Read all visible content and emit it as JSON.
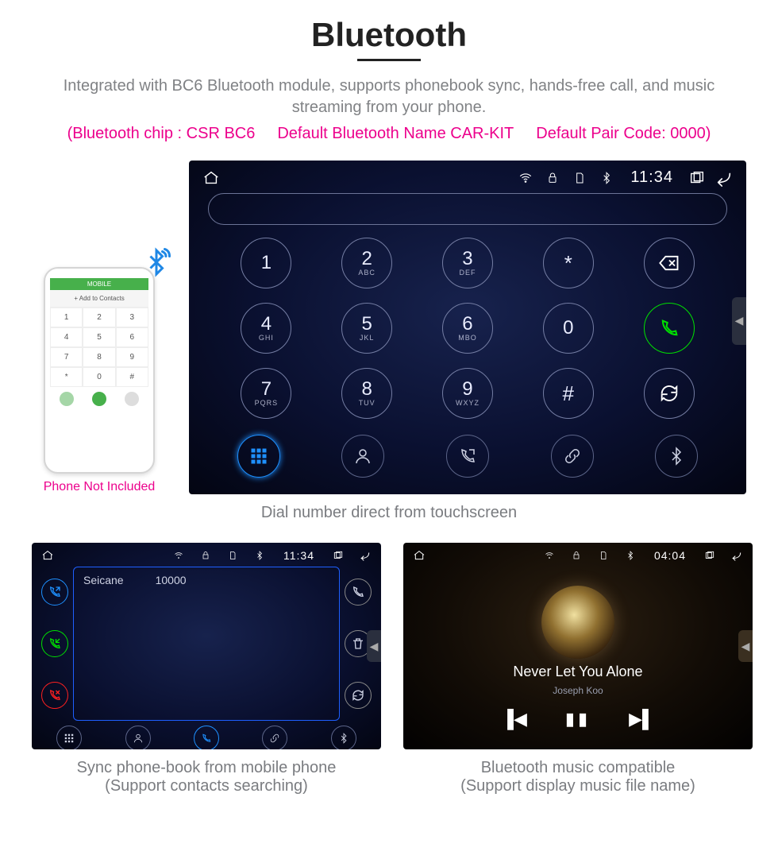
{
  "header": {
    "title": "Bluetooth",
    "description": "Integrated with BC6 Bluetooth module, supports phonebook sync, hands-free call, and music streaming from your phone.",
    "chip": "(Bluetooth chip : CSR BC6",
    "default_name": "Default Bluetooth Name CAR-KIT",
    "default_code": "Default Pair Code: 0000)"
  },
  "phone_note": "Phone Not Included",
  "phone_mock": {
    "topbar": "MOBILE",
    "add_label": "Add to Contacts",
    "keys": [
      "1",
      "2",
      "3",
      "4",
      "5",
      "6",
      "7",
      "8",
      "9",
      "*",
      "0",
      "#"
    ]
  },
  "main_unit": {
    "clock": "11:34",
    "keys": [
      {
        "n": "1",
        "s": ""
      },
      {
        "n": "2",
        "s": "ABC"
      },
      {
        "n": "3",
        "s": "DEF"
      },
      {
        "n": "*",
        "s": ""
      },
      {
        "icon": "backspace"
      },
      {
        "n": "4",
        "s": "GHI"
      },
      {
        "n": "5",
        "s": "JKL"
      },
      {
        "n": "6",
        "s": "MBO"
      },
      {
        "n": "0",
        "s": ""
      },
      {
        "icon": "call"
      },
      {
        "n": "7",
        "s": "PQRS"
      },
      {
        "n": "8",
        "s": "TUV"
      },
      {
        "n": "9",
        "s": "WXYZ"
      },
      {
        "n": "#",
        "s": ""
      },
      {
        "icon": "sync"
      }
    ],
    "tabs": [
      "dialpad",
      "profile",
      "phone",
      "link",
      "bt"
    ],
    "caption": "Dial number direct from touchscreen"
  },
  "phonebook_unit": {
    "clock": "11:34",
    "contact_name": "Seicane",
    "contact_number": "10000",
    "caption1": "Sync phone-book from mobile phone",
    "caption2": "(Support contacts searching)"
  },
  "music_unit": {
    "clock": "04:04",
    "track": "Never Let You Alone",
    "artist": "Joseph Koo",
    "caption1": "Bluetooth music compatible",
    "caption2": "(Support display music file name)"
  }
}
